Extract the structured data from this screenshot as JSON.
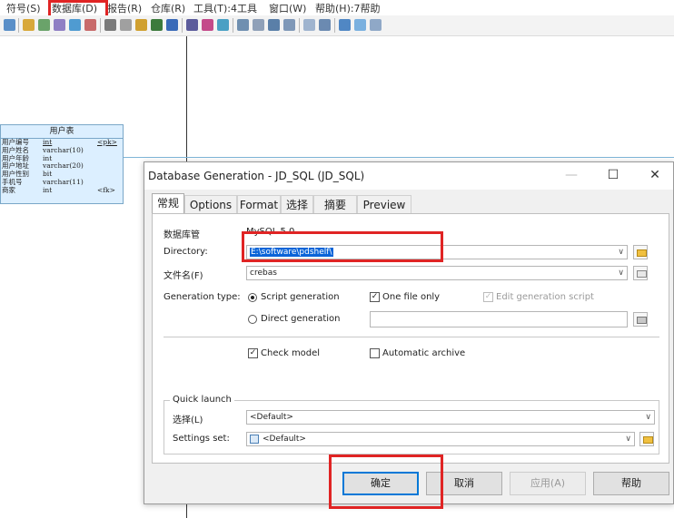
{
  "menubar": {
    "items": [
      "符号(S)",
      "数据库(D)",
      "报告(R)",
      "仓库(R)",
      "工具(T):4工具",
      "窗口(W)",
      "帮助(H):7帮助"
    ]
  },
  "entity": {
    "title": "用户表",
    "columns": [
      {
        "name": "用户编号",
        "type": "int",
        "key": "<pk>"
      },
      {
        "name": "用户姓名",
        "type": "varchar(10)",
        "key": ""
      },
      {
        "name": "用户年龄",
        "type": "int",
        "key": ""
      },
      {
        "name": "用户地址",
        "type": "varchar(20)",
        "key": ""
      },
      {
        "name": "用户性别",
        "type": "bit",
        "key": ""
      },
      {
        "name": "手机号",
        "type": "varchar(11)",
        "key": ""
      },
      {
        "name": "商家",
        "type": "int",
        "key": "<fk>"
      }
    ]
  },
  "dialog": {
    "title": "Database Generation - JD_SQL (JD_SQL)",
    "minimize": "—",
    "maximize": "☐",
    "close": "✕",
    "tabs": [
      "常规",
      "Options",
      "Format",
      "选择",
      "摘要",
      "Preview"
    ],
    "active_tab": "常规",
    "dbms_label": "数据库管",
    "dbms_value": "MySQL 5.0",
    "directory_label": "Directory:",
    "directory_value": "E:\\software\\pdshelf\\",
    "filename_label": "文件名(F)",
    "filename_value": "crebas",
    "gen_type_label": "Generation type:",
    "script_generation": "Script generation",
    "direct_generation": "Direct generation",
    "one_file_only": "One file only",
    "edit_generation_script": "Edit generation script",
    "check_model": "Check model",
    "automatic_archive": "Automatic archive",
    "quick_launch_title": "Quick launch",
    "selection_label": "选择(L)",
    "selection_value": "<Default>",
    "settings_set_label": "Settings set:",
    "settings_set_value": "<Default>",
    "buttons": {
      "ok": "确定",
      "cancel": "取消",
      "apply": "应用(A)",
      "help": "帮助"
    },
    "check_glyph": "✓"
  },
  "colors": {
    "highlight": "#e02424",
    "entity_fill": "#dcefff",
    "accent": "#0078d7"
  }
}
